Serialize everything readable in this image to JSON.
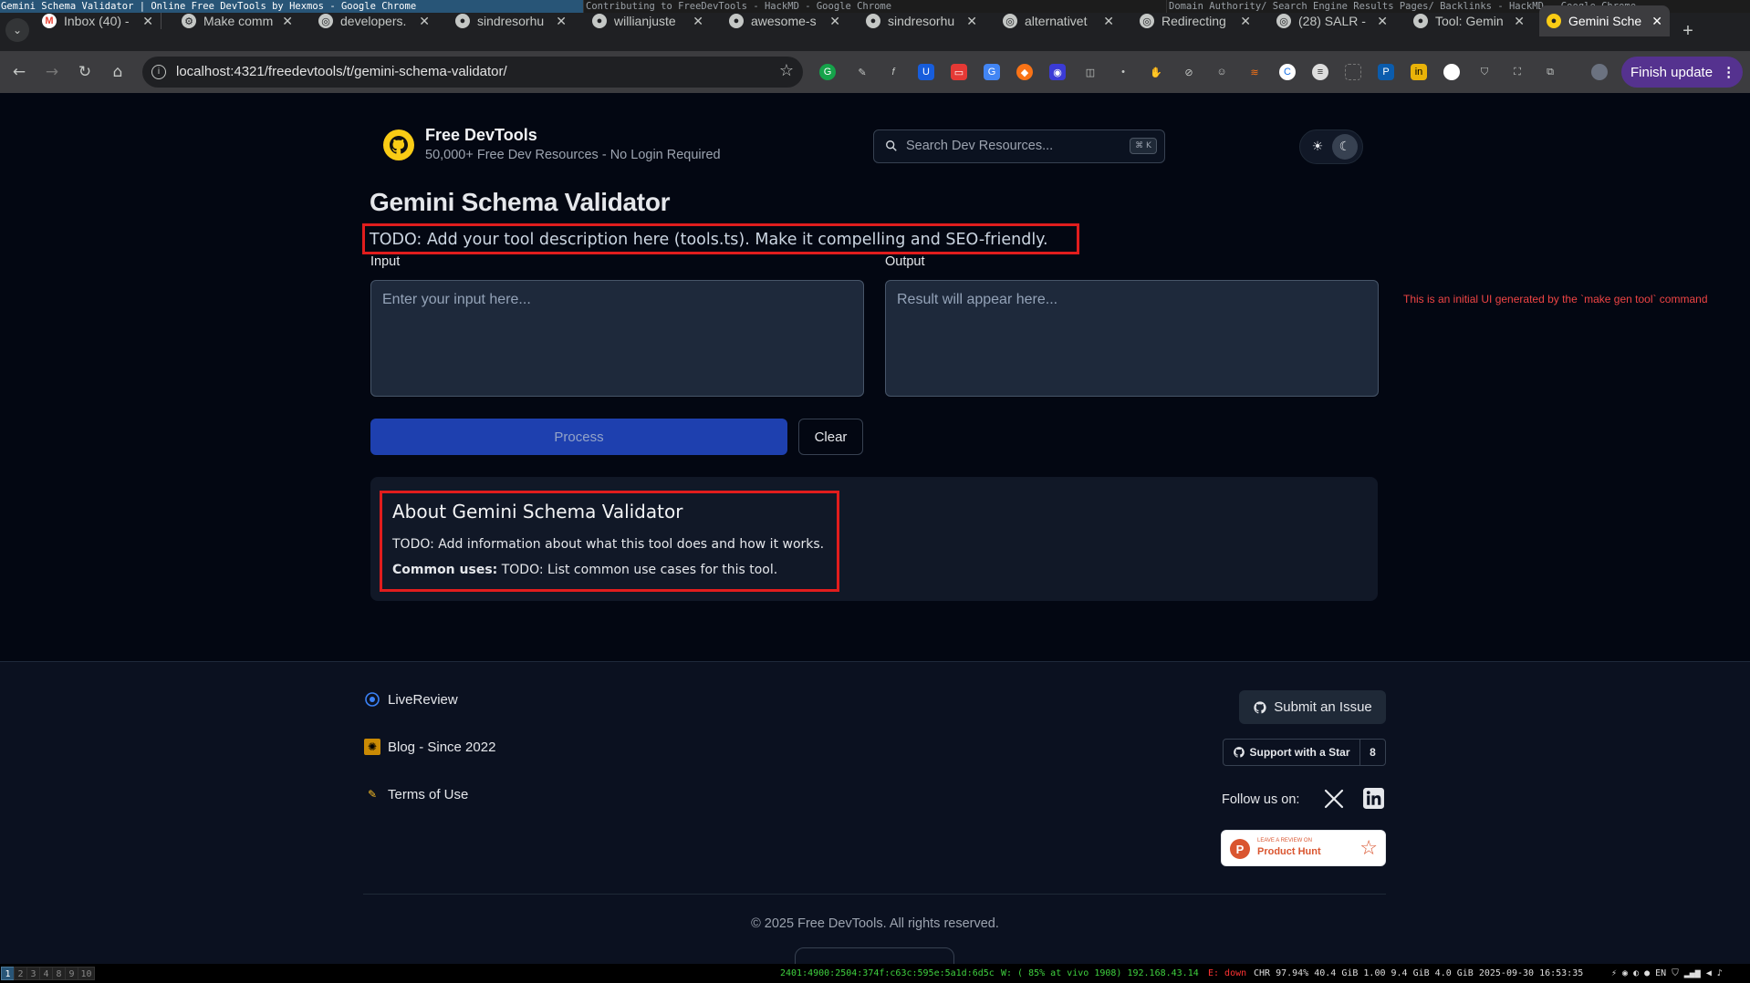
{
  "wm": {
    "active_title": "Gemini Schema Validator | Online Free DevTools by Hexmos - Google Chrome",
    "middle_title": "Contributing to FreeDevTools - HackMD - Google Chrome",
    "right_title": "Domain Authority/ Search Engine Results Pages/ Backlinks - HackMD - Google Chrome"
  },
  "tabs": [
    {
      "label": "Inbox (40) -"
    },
    {
      "label": "Make comm"
    },
    {
      "label": "developers."
    },
    {
      "label": "sindresorhu"
    },
    {
      "label": "willianjuste"
    },
    {
      "label": "awesome-s"
    },
    {
      "label": "sindresorhu"
    },
    {
      "label": "alternativet"
    },
    {
      "label": "Redirecting"
    },
    {
      "label": "(28) SALR -"
    },
    {
      "label": "Tool: Gemin"
    },
    {
      "label": "Gemini Sche"
    }
  ],
  "omnibox": {
    "url": "localhost:4321/freedevtools/t/gemini-schema-validator/"
  },
  "browser": {
    "finish_update": "Finish update"
  },
  "header": {
    "title": "Free DevTools",
    "subtitle": "50,000+ Free Dev Resources - No Login Required",
    "search_placeholder": "Search Dev Resources...",
    "search_kbd": "⌘ K"
  },
  "tool": {
    "title": "Gemini Schema Validator",
    "description": "TODO: Add your tool description here (tools.ts). Make it compelling and SEO-friendly.",
    "input_label": "Input",
    "output_label": "Output",
    "input_placeholder": "Enter your input here...",
    "output_placeholder": "Result will appear here...",
    "process_label": "Process",
    "clear_label": "Clear",
    "note": "This is an initial UI generated by the `make gen tool` command"
  },
  "about": {
    "title": "About Gemini Schema Validator",
    "line1": "TODO: Add information about what this tool does and how it works.",
    "uses_label": "Common uses:",
    "uses_text": " TODO: List common use cases for this tool."
  },
  "footer": {
    "links": [
      {
        "label": "LiveReview"
      },
      {
        "label": "Blog - Since 2022"
      },
      {
        "label": "Terms of Use"
      }
    ],
    "submit_issue": "Submit an Issue",
    "support_star": "Support with a Star",
    "star_count": "8",
    "follow": "Follow us on:",
    "ph_small": "LEAVE A REVIEW ON",
    "ph_big": "Product Hunt",
    "copyright": "© 2025 Free DevTools. All rights reserved."
  },
  "statusbar": {
    "workspaces": [
      "1",
      "2",
      "3",
      "4",
      "8",
      "9",
      "10"
    ],
    "net": "2401:4900:2504:374f:c63c:595e:5a1d:6d5c",
    "wifi": "W: ( 85% at vivo 1908) 192.168.43.14",
    "eth": "E: down",
    "stats": "CHR 97.94% 40.4 GiB 1.00 9.4 GiB 4.0 GiB 2025-09-30 16:53:35"
  },
  "colors": {
    "accent": "#1e40af",
    "highlight": "#e11d1d",
    "logo": "#facc15"
  }
}
